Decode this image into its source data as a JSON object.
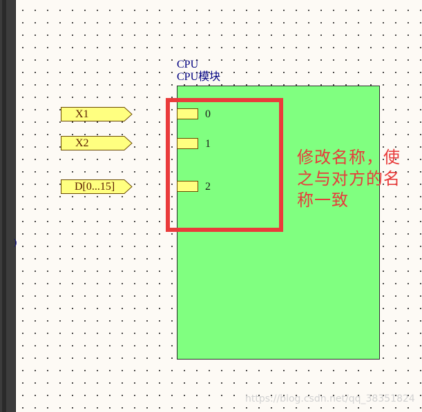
{
  "ports": [
    {
      "label": "X1"
    },
    {
      "label": "X2"
    },
    {
      "label": "D[0...15]"
    }
  ],
  "component": {
    "designator": "CPU",
    "name": "CPU模块",
    "pins": [
      {
        "number": "0"
      },
      {
        "number": "1"
      },
      {
        "number": "2"
      }
    ]
  },
  "stray_mark": ")",
  "annotation": {
    "text": "修改名称，使之与对方的名称一致"
  },
  "watermark": "https://blog.csdn.net/qq_38351824",
  "colors": {
    "component_fill": "#80ff80",
    "port_fill": "#ffff80",
    "pin_fill": "#ffff80",
    "highlight": "#ea3b3b",
    "title_text": "#000080"
  }
}
